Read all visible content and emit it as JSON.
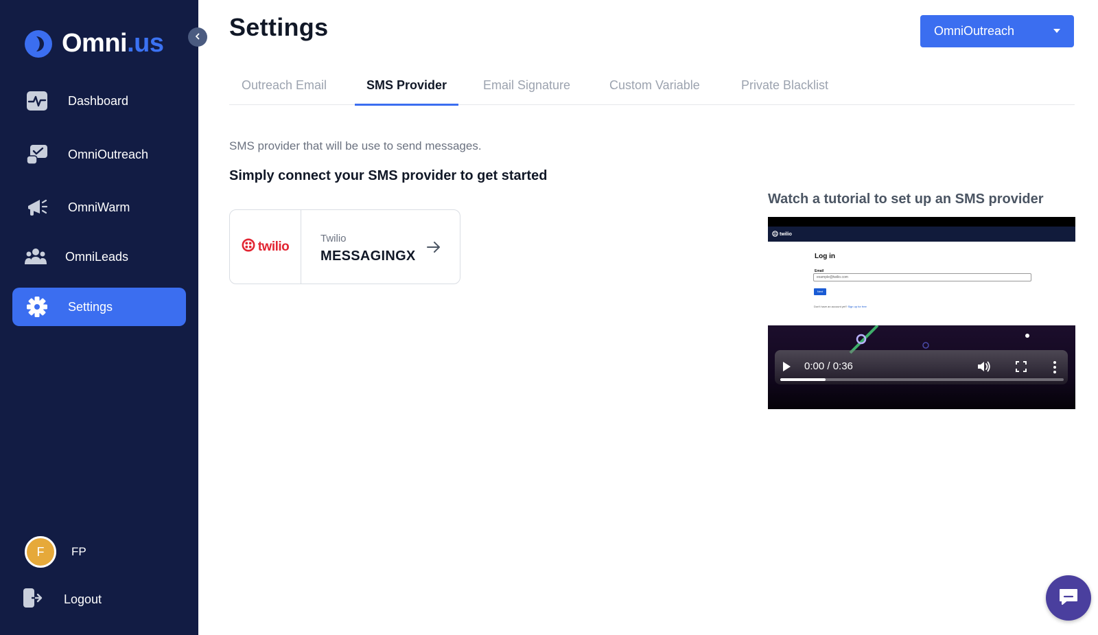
{
  "app": {
    "logo_main": "Omni",
    "logo_accent": ".us"
  },
  "sidebar": {
    "items": [
      {
        "label": "Dashboard",
        "icon": "dashboard-icon"
      },
      {
        "label": "OmniOutreach",
        "icon": "outreach-icon"
      },
      {
        "label": "OmniWarm",
        "icon": "megaphone-icon"
      },
      {
        "label": "OmniLeads",
        "icon": "users-icon"
      },
      {
        "label": "Settings",
        "icon": "gear-icon",
        "active": true
      }
    ],
    "user": {
      "initial": "F",
      "name": "FP"
    },
    "logout_label": "Logout"
  },
  "page": {
    "title": "Settings"
  },
  "product_select": {
    "selected": "OmniOutreach"
  },
  "tabs": [
    {
      "label": "Outreach Email"
    },
    {
      "label": "SMS Provider",
      "active": true
    },
    {
      "label": "Email Signature"
    },
    {
      "label": "Custom Variable"
    },
    {
      "label": "Private Blacklist"
    }
  ],
  "content": {
    "subtitle": "SMS provider that will be use to send messages.",
    "heading": "Simply connect your SMS provider to get started"
  },
  "provider": {
    "logo_text": "twilio",
    "name": "Twilio",
    "account": "MESSAGINGX"
  },
  "tutorial": {
    "title": "Watch a tutorial to set up an SMS provider",
    "video": {
      "header_brand": "twilio",
      "frame_title": "Log in",
      "frame_label": "Email",
      "frame_input_value": "example@twilio.com",
      "frame_button": "Next",
      "frame_footer_text": "Don't have an account yet?",
      "frame_footer_link": "Sign up for free",
      "time": "0:00 / 0:36",
      "progress": 0.16
    }
  },
  "colors": {
    "sidebar_bg": "#121c44",
    "accent": "#3b6ef0",
    "avatar": "#e6a93a",
    "chat": "#4a3f9e"
  }
}
